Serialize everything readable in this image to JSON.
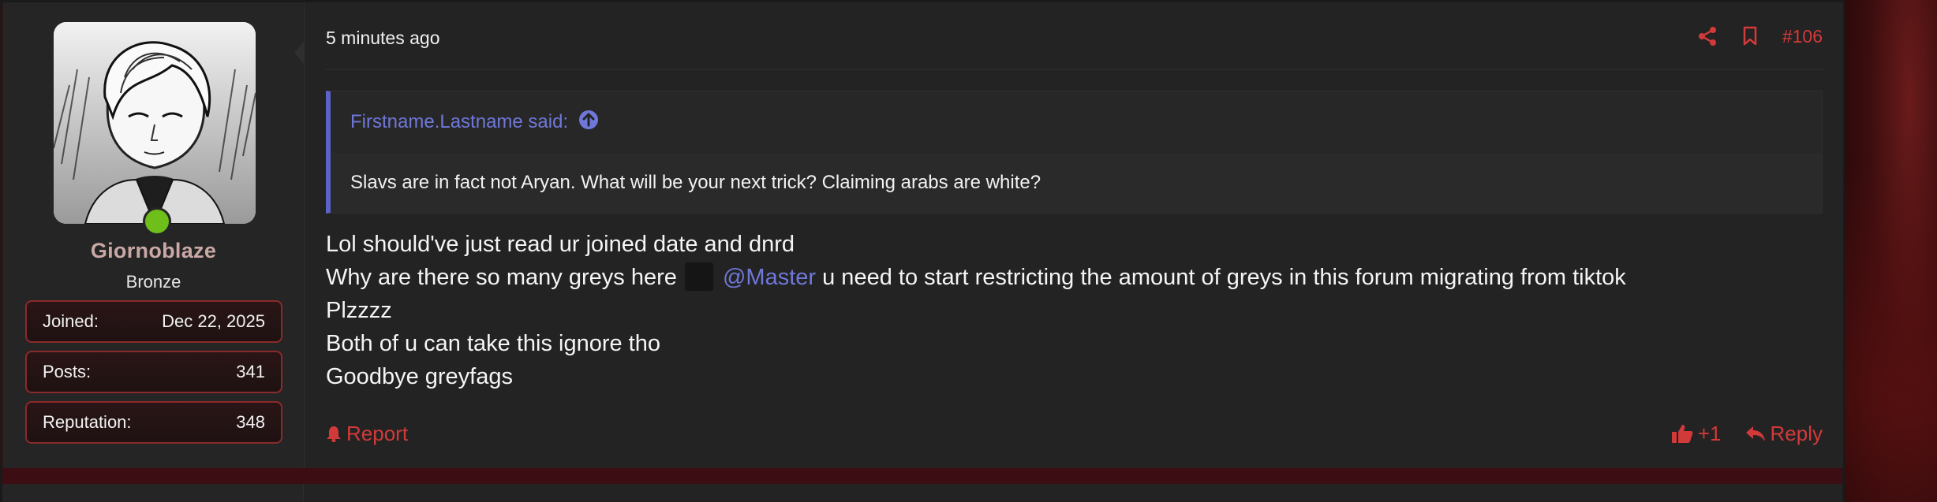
{
  "user": {
    "username": "Giornoblaze",
    "rank": "Bronze",
    "stats": [
      {
        "label": "Joined:",
        "value": "Dec 22, 2025"
      },
      {
        "label": "Posts:",
        "value": "341"
      },
      {
        "label": "Reputation:",
        "value": "348"
      }
    ]
  },
  "post": {
    "timestamp": "5 minutes ago",
    "number": "#106",
    "icons": {
      "share": "share-icon",
      "bookmark": "bookmark-icon"
    },
    "quote": {
      "author": "Firstname.Lastname said:",
      "text": "Slavs are in fact not Aryan. What will be your next trick? Claiming arabs are white?"
    },
    "message": {
      "line1": "Lol should've just read ur joined date and dnrd",
      "line2_before": "Why are there so many greys here",
      "line2_mention": "@Master",
      "line2_after": "u need to start restricting the amount of greys in this forum migrating from tiktok",
      "line3": "Plzzzz",
      "line4": "Both of u can take this ignore tho",
      "line5": "Goodbye greyfags"
    },
    "footer": {
      "report_label": "Report",
      "like_count": "+1",
      "reply_label": "Reply"
    }
  },
  "colors": {
    "accent_red": "#d23a3a",
    "mention_blue": "#6f78d9",
    "online_green": "#6fbf1b"
  }
}
